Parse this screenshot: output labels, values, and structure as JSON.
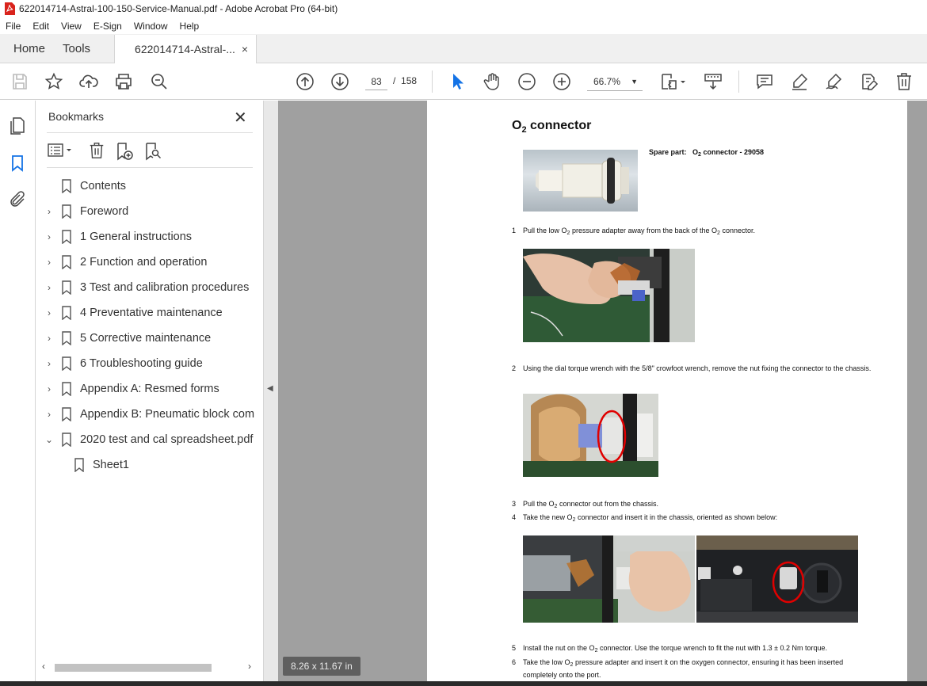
{
  "window": {
    "title": "622014714-Astral-100-150-Service-Manual.pdf - Adobe Acrobat Pro (64-bit)"
  },
  "menu": [
    "File",
    "Edit",
    "View",
    "E-Sign",
    "Window",
    "Help"
  ],
  "tabs": {
    "home": "Home",
    "tools": "Tools",
    "document": "622014714-Astral-...",
    "close_glyph": "×"
  },
  "toolbar": {
    "current_page": "83",
    "page_separator": "/",
    "total_pages": "158",
    "zoom": "66.7%"
  },
  "bookmarks": {
    "title": "Bookmarks",
    "close_glyph": "✕",
    "items": [
      {
        "label": "Contents",
        "expand": ""
      },
      {
        "label": "Foreword",
        "expand": "›"
      },
      {
        "label": "1 General instructions",
        "expand": "›"
      },
      {
        "label": "2 Function and operation",
        "expand": "›"
      },
      {
        "label": "3 Test and calibration procedures",
        "expand": "›"
      },
      {
        "label": "4 Preventative maintenance",
        "expand": "›"
      },
      {
        "label": "5 Corrective maintenance",
        "expand": "›"
      },
      {
        "label": "6 Troubleshooting guide",
        "expand": "›"
      },
      {
        "label": "Appendix A: Resmed forms",
        "expand": "›"
      },
      {
        "label": "Appendix B: Pneumatic block com",
        "expand": "›"
      },
      {
        "label": "2020 test and cal spreadsheet.pdf",
        "expand": "⌄"
      },
      {
        "label": "Sheet1",
        "expand": ""
      }
    ]
  },
  "document": {
    "page_size": "8.26 x 11.67 in",
    "heading_main": "O",
    "heading_sub": "2",
    "heading_rest": " connector",
    "spare_part_label": "Spare part:",
    "spare_part_value_a": "O",
    "spare_part_value_sub": "2",
    "spare_part_value_b": " connector - 29058",
    "steps": [
      {
        "num": "1",
        "a": "Pull the low O",
        "b": " pressure adapter away from the back of the O",
        "c": " connector.",
        "d": ""
      },
      {
        "num": "2",
        "a": "Using the dial torque wrench with the 5/8\" crowfoot wrench, remove the nut fixing the connector to the chassis.",
        "b": "",
        "c": "",
        "d": ""
      },
      {
        "num": "3",
        "a": "Pull the O",
        "b": " connector out from the chassis.",
        "c": "",
        "d": ""
      },
      {
        "num": "4",
        "a": "Take the new O",
        "b": " connector and insert it in the chassis, oriented as shown below:",
        "c": "",
        "d": ""
      },
      {
        "num": "5",
        "a": "Install the nut on the O",
        "b": " connector. Use the torque wrench to fit the nut with 1.3 ± 0.2 Nm torque.",
        "c": "",
        "d": ""
      },
      {
        "num": "6",
        "a": "Take the low O",
        "b": " pressure adapter and insert it on the oxygen connector, ensuring it has been inserted completely onto the port.",
        "c": "",
        "d": ""
      }
    ],
    "subscript": "2"
  },
  "icons": {
    "save": "save-icon",
    "bookmark_star": "star-icon",
    "upload": "upload-icon",
    "print": "print-icon",
    "search": "zoom-search-icon",
    "page_up": "page-up-icon",
    "page_down": "page-down-icon",
    "select": "select-cursor-icon",
    "hand": "hand-icon",
    "zoom_out": "zoom-out-icon",
    "zoom_in": "zoom-in-icon",
    "fit": "fit-page-icon",
    "scroll_mode": "scroll-mode-icon",
    "comment": "comment-icon",
    "highlight": "highlight-icon",
    "sign": "sign-icon",
    "edit": "edit-icon",
    "delete": "delete-icon"
  },
  "colors": {
    "acrobat_red": "#d9231c",
    "select_blue": "#1473e6",
    "doc_bg": "#a0a0a0",
    "circle_red": "#e00000"
  }
}
